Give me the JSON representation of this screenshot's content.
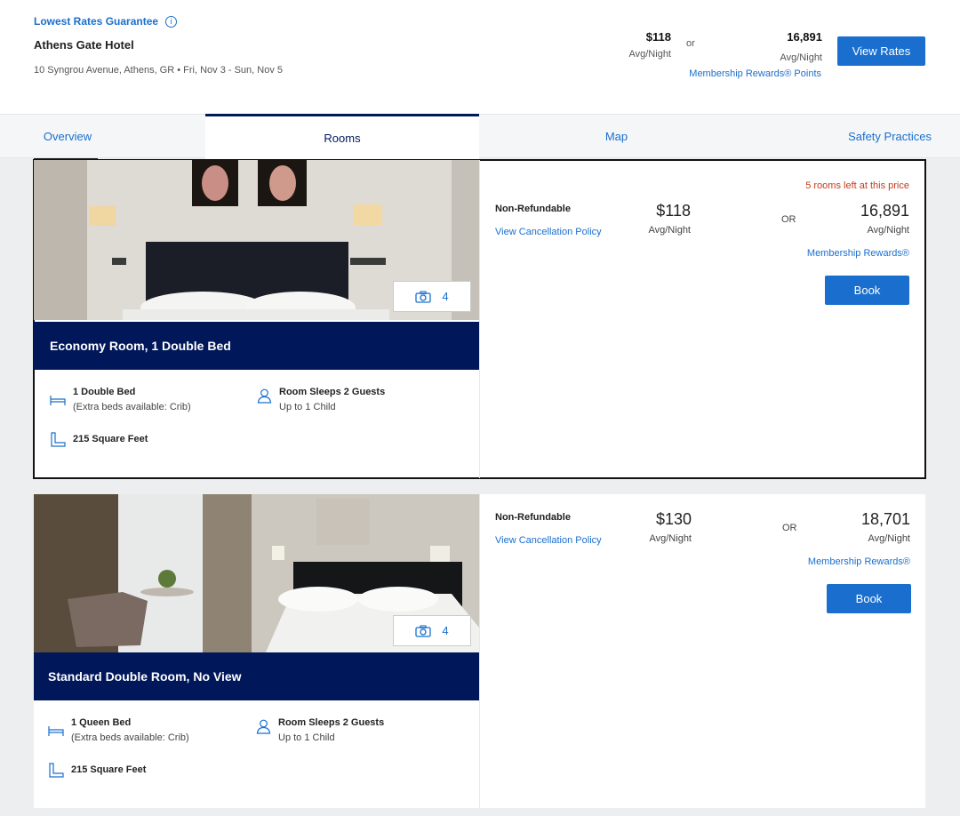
{
  "header": {
    "guarantee": "Lowest Rates Guarantee",
    "guarantee_icon": "info-icon",
    "hotel_name": "Athens Gate Hotel",
    "address_dates": "10 Syngrou Avenue, Athens, GR • Fri, Nov 3 - Sun, Nov 5",
    "cash_price": "$118",
    "cash_sub": "Avg/Night",
    "or": "or",
    "points_price": "16,891",
    "points_sub": "Avg/Night",
    "points_link": "Membership Rewards® Points",
    "view_rates": "View Rates"
  },
  "tabs": [
    {
      "label": "Overview",
      "active": false
    },
    {
      "label": "Rooms",
      "active": true
    },
    {
      "label": "Map",
      "active": false
    },
    {
      "label": "Safety Practices",
      "active": false
    }
  ],
  "rooms": [
    {
      "title": "Economy Room, 1 Double Bed",
      "photo_count": "4",
      "bed": "1 Double Bed",
      "extra_beds": "(Extra beds available: Crib)",
      "sleeps": "Room Sleeps 2 Guests",
      "children": "Up to 1 Child",
      "size": "215 Square Feet",
      "rate_type": "Non-Refundable",
      "cancel_link": "View Cancellation Policy",
      "cash_price": "$118",
      "cash_sub": "Avg/Night",
      "or": "OR",
      "points_price": "16,891",
      "points_sub": "Avg/Night",
      "rooms_left": "5 rooms left at this price",
      "mr_link": "Membership Rewards®",
      "book": "Book"
    },
    {
      "title": "Standard Double Room, No View",
      "photo_count": "4",
      "bed": "1 Queen Bed",
      "extra_beds": "(Extra beds available: Crib)",
      "sleeps": "Room Sleeps 2 Guests",
      "children": "Up to 1 Child",
      "size": "215 Square Feet",
      "rate_type": "Non-Refundable",
      "cancel_link": "View Cancellation Policy",
      "cash_price": "$130",
      "cash_sub": "Avg/Night",
      "or": "OR",
      "points_price": "18,701",
      "points_sub": "Avg/Night",
      "mr_link": "Membership Rewards®",
      "book": "Book"
    }
  ],
  "colors": {
    "brand_blue": "#1a6fce",
    "navy": "#00175a",
    "alert_red": "#c8381c"
  },
  "icons": [
    "camera-icon",
    "bed-icon",
    "guest-icon",
    "floor-area-icon"
  ]
}
